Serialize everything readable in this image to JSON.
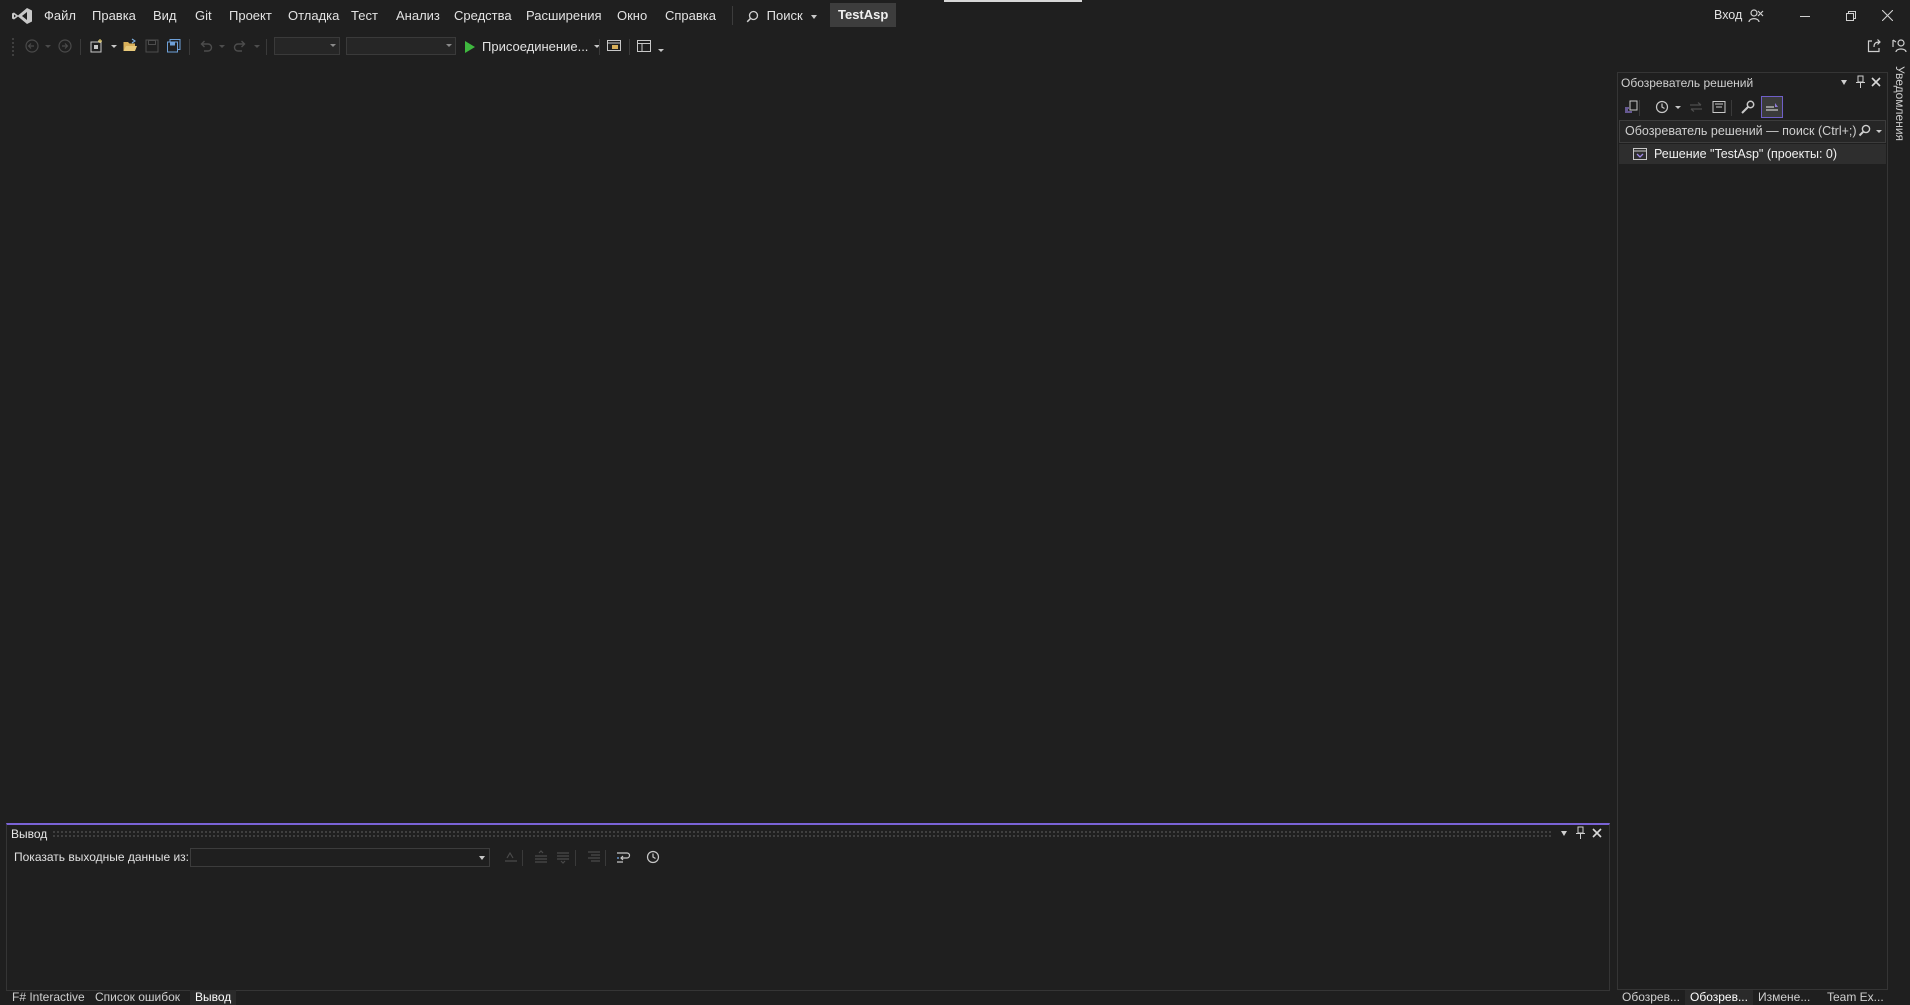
{
  "menu": {
    "items": [
      "Файл",
      "Правка",
      "Вид",
      "Git",
      "Проект",
      "Отладка",
      "Тест",
      "Анализ",
      "Средства",
      "Расширения",
      "Окно",
      "Справка"
    ],
    "search_label": "Поиск",
    "solution_name": "TestAsp",
    "signin_label": "Вход"
  },
  "toolbar": {
    "run_label": "Присоединение..."
  },
  "solution_explorer": {
    "title": "Обозреватель решений",
    "search_placeholder": "Обозреватель решений — поиск (Ctrl+;)",
    "root_item": "Решение \"TestAsp\" (проекты: 0)"
  },
  "side_tab": {
    "label": "Уведомления"
  },
  "output": {
    "title": "Вывод",
    "show_output_from_label": "Показать выходные данные из:",
    "source_value": ""
  },
  "bottom_tabs_left": [
    "F# Interactive",
    "Список ошибок",
    "Вывод"
  ],
  "bottom_tabs_left_active": 2,
  "bottom_tabs_right": [
    "Обозрев...",
    "Обозрев...",
    "Измене...",
    "Team Ex..."
  ],
  "bottom_tabs_right_active": 1,
  "colors": {
    "background": "#1f1f1f",
    "accent": "#7a63d6",
    "run_green": "#3fb83f",
    "text": "#d6d6d6"
  },
  "icons": {
    "logo": "visual-studio-logo-icon",
    "run": "play-icon",
    "search": "search-icon"
  }
}
